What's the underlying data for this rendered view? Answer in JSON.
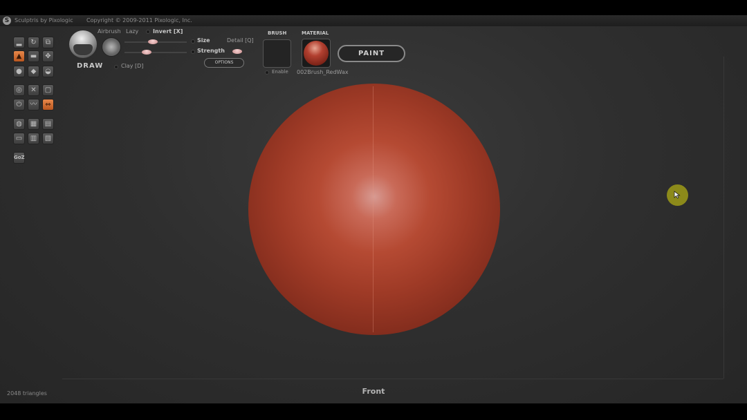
{
  "titlebar": {
    "app_name": "Sculptris by Pixologic",
    "copyright": "Copyright © 2009-2011 Pixologic, Inc."
  },
  "tools": {
    "rows": [
      [
        "crease",
        "rotate",
        "scale"
      ],
      [
        "draw",
        "flatten",
        "grab"
      ],
      [
        "inflate",
        "pinch",
        "smooth"
      ],
      [
        "reduce-brush",
        "mask",
        "reduce-selected"
      ],
      [
        "subdivide-all",
        "reduce-all",
        "symmetry"
      ],
      [
        "sphere",
        "new-scene",
        "open"
      ],
      [
        "import",
        "save",
        "export"
      ]
    ],
    "goz_label": "GoZ"
  },
  "brush": {
    "name": "DRAW",
    "airbrush_label": "Airbrush",
    "lazy_label": "Lazy",
    "invert_label": "Invert [X]",
    "size_label": "Size",
    "strength_label": "Strength",
    "detail_label": "Detail [Q]",
    "clay_label": "Clay [D]",
    "options_label": "OPTIONS",
    "size_value": 0.45,
    "strength_value": 0.36
  },
  "paint_panel": {
    "brush_heading": "BRUSH",
    "material_heading": "MATERIAL",
    "enable_label": "Enable",
    "material_name": "002Brush_RedWax",
    "paint_button": "PAINT"
  },
  "status": {
    "triangles": "2048 triangles",
    "view": "Front"
  },
  "colors": {
    "accent_orange": "#d66a2e",
    "material_red": "#a33a27",
    "cursor": "#8c8a1a"
  }
}
